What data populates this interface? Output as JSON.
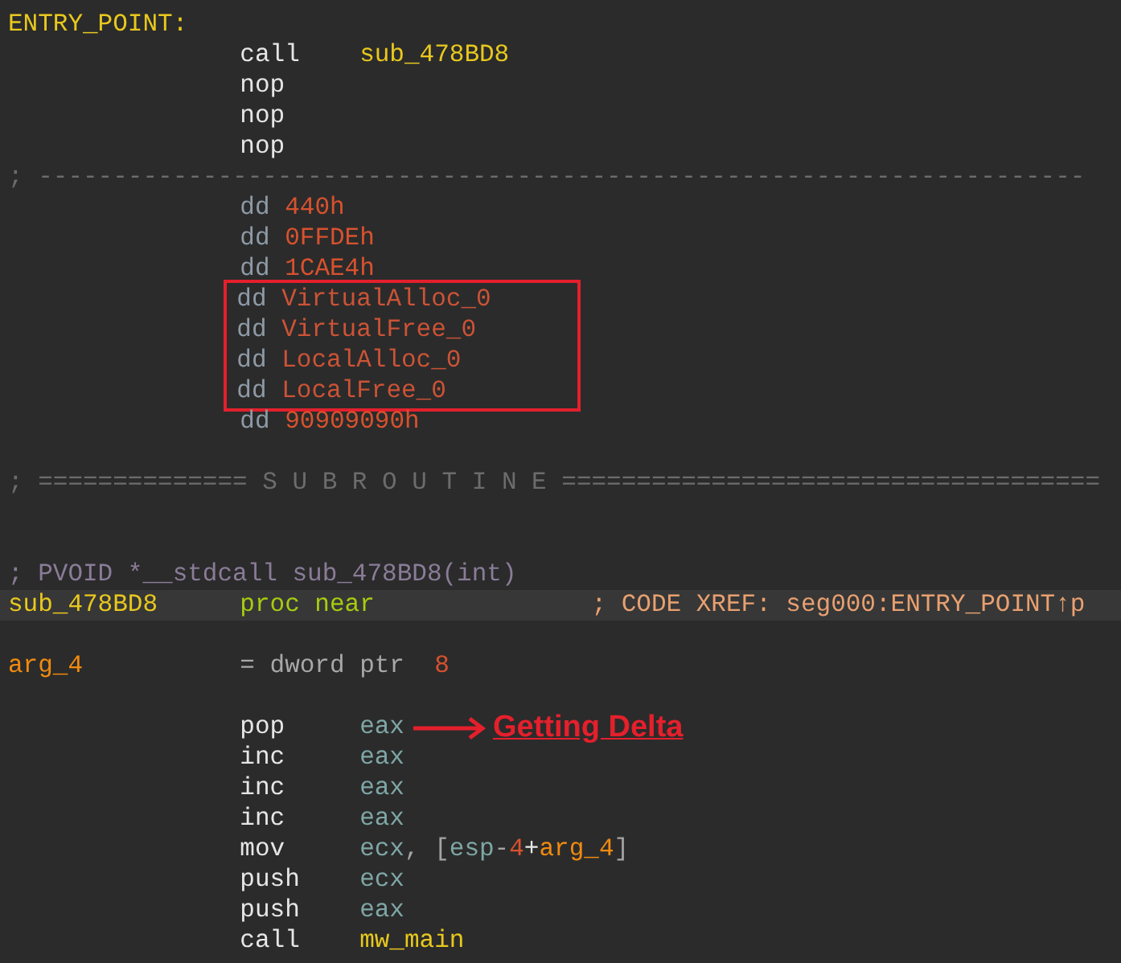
{
  "lines": [
    {
      "kind": "code",
      "selected": false,
      "label": {
        "text": "ENTRY_POINT:",
        "kind": "label"
      }
    },
    {
      "kind": "code",
      "selected": false,
      "op": {
        "text": "call",
        "kind": "mnem"
      },
      "args": [
        {
          "text": "sub_478BD8",
          "kind": "func"
        }
      ]
    },
    {
      "kind": "code",
      "selected": false,
      "op": {
        "text": "nop",
        "kind": "mnem"
      }
    },
    {
      "kind": "code",
      "selected": false,
      "op": {
        "text": "nop",
        "kind": "mnem"
      }
    },
    {
      "kind": "code",
      "selected": false,
      "op": {
        "text": "nop",
        "kind": "mnem"
      }
    },
    {
      "kind": "comment",
      "text": "; ----------------------------------------------------------------------"
    },
    {
      "kind": "code",
      "selected": false,
      "op": {
        "text": "dd",
        "kind": "directive"
      },
      "args": [
        {
          "text": "440h",
          "kind": "num"
        }
      ]
    },
    {
      "kind": "code",
      "selected": false,
      "op": {
        "text": "dd",
        "kind": "directive"
      },
      "args": [
        {
          "text": "0FFDEh",
          "kind": "num"
        }
      ]
    },
    {
      "kind": "code",
      "selected": false,
      "op": {
        "text": "dd",
        "kind": "directive"
      },
      "args": [
        {
          "text": "1CAE4h",
          "kind": "num"
        }
      ]
    },
    {
      "kind": "code",
      "selected": false,
      "boxed": true,
      "op": {
        "text": "dd",
        "kind": "directive"
      },
      "args": [
        {
          "text": "VirtualAlloc_0",
          "kind": "dref"
        }
      ]
    },
    {
      "kind": "code",
      "selected": false,
      "boxed": true,
      "op": {
        "text": "dd",
        "kind": "directive"
      },
      "args": [
        {
          "text": "VirtualFree_0",
          "kind": "dref"
        }
      ]
    },
    {
      "kind": "code",
      "selected": false,
      "boxed": true,
      "op": {
        "text": "dd",
        "kind": "directive"
      },
      "args": [
        {
          "text": "LocalAlloc_0",
          "kind": "dref"
        }
      ]
    },
    {
      "kind": "code",
      "selected": false,
      "boxed": true,
      "op": {
        "text": "dd",
        "kind": "directive"
      },
      "args": [
        {
          "text": "LocalFree_0",
          "kind": "dref"
        }
      ]
    },
    {
      "kind": "code",
      "selected": false,
      "op": {
        "text": "dd",
        "kind": "directive"
      },
      "args": [
        {
          "text": "90909090h",
          "kind": "num"
        }
      ]
    },
    {
      "kind": "blank"
    },
    {
      "kind": "comment",
      "text": "; ============== S U B R O U T I N E ===================================="
    },
    {
      "kind": "blank"
    },
    {
      "kind": "blank"
    },
    {
      "kind": "prototype",
      "text": "; PVOID *__stdcall sub_478BD8(int)"
    },
    {
      "kind": "code",
      "selected": true,
      "label": {
        "text": "sub_478BD8",
        "kind": "label"
      },
      "op": {
        "text": "proc near",
        "kind": "proc"
      },
      "comment": {
        "text": "; CODE XREF: seg000:ENTRY_POINT↑p",
        "kind": "xref"
      }
    },
    {
      "kind": "blank"
    },
    {
      "kind": "code",
      "selected": false,
      "label": {
        "text": "arg_4",
        "kind": "local"
      },
      "args": [
        {
          "text": "= dword ptr  ",
          "kind": "plain"
        },
        {
          "text": "8",
          "kind": "num"
        }
      ]
    },
    {
      "kind": "blank"
    },
    {
      "kind": "code",
      "selected": false,
      "op": {
        "text": "pop",
        "kind": "mnem"
      },
      "args": [
        {
          "text": "eax",
          "kind": "reg"
        }
      ],
      "annotation": "Getting Delta"
    },
    {
      "kind": "code",
      "selected": false,
      "op": {
        "text": "inc",
        "kind": "mnem"
      },
      "args": [
        {
          "text": "eax",
          "kind": "reg"
        }
      ]
    },
    {
      "kind": "code",
      "selected": false,
      "op": {
        "text": "inc",
        "kind": "mnem"
      },
      "args": [
        {
          "text": "eax",
          "kind": "reg"
        }
      ]
    },
    {
      "kind": "code",
      "selected": false,
      "op": {
        "text": "inc",
        "kind": "mnem"
      },
      "args": [
        {
          "text": "eax",
          "kind": "reg"
        }
      ]
    },
    {
      "kind": "code",
      "selected": false,
      "op": {
        "text": "mov",
        "kind": "mnem"
      },
      "args": [
        {
          "text": "ecx",
          "kind": "reg"
        },
        {
          "text": ", [",
          "kind": "punct"
        },
        {
          "text": "esp",
          "kind": "reg"
        },
        {
          "text": "-",
          "kind": "punct"
        },
        {
          "text": "4",
          "kind": "num"
        },
        {
          "text": "+",
          "kind": "mnem"
        },
        {
          "text": "arg_4",
          "kind": "local"
        },
        {
          "text": "]",
          "kind": "punct"
        }
      ]
    },
    {
      "kind": "code",
      "selected": false,
      "op": {
        "text": "push",
        "kind": "mnem"
      },
      "args": [
        {
          "text": "ecx",
          "kind": "reg"
        }
      ]
    },
    {
      "kind": "code",
      "selected": false,
      "op": {
        "text": "push",
        "kind": "mnem"
      },
      "args": [
        {
          "text": "eax",
          "kind": "reg"
        }
      ]
    },
    {
      "kind": "code",
      "selected": false,
      "op": {
        "text": "call",
        "kind": "mnem"
      },
      "args": [
        {
          "text": "mw_main",
          "kind": "func"
        }
      ]
    }
  ]
}
